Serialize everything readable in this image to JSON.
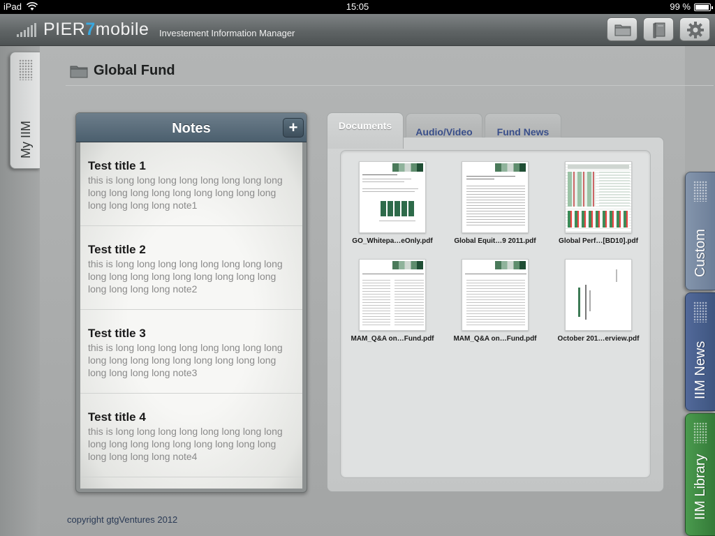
{
  "status_bar": {
    "device": "iPad",
    "time": "15:05",
    "battery": "99 %"
  },
  "header": {
    "logo_prefix": "PIER",
    "logo_seven": "7",
    "logo_suffix": "mobile",
    "tagline": "Investement Information Manager",
    "buttons": [
      {
        "name": "folder-button",
        "icon": "folder-icon"
      },
      {
        "name": "book-button",
        "icon": "book-icon"
      },
      {
        "name": "settings-button",
        "icon": "gear-icon"
      }
    ]
  },
  "left_tab": {
    "label": "My IIM"
  },
  "page": {
    "title": "Global Fund"
  },
  "notes": {
    "title": "Notes",
    "add_label": "+",
    "items": [
      {
        "title": "Test title 1",
        "body": "this is long long long long long long long long long long long long long long long long long long long long long note1"
      },
      {
        "title": "Test title 2",
        "body": "this is long long long long long long long long long long long long long long long long long long long long long note2"
      },
      {
        "title": "Test title 3",
        "body": "this is long long long long long long long long long long long long long long long long long long long long long note3"
      },
      {
        "title": "Test title 4",
        "body": "this is long long long long long long long long long long long long long long long long long long long long long note4"
      }
    ]
  },
  "docs": {
    "tabs": [
      {
        "label": "Documents",
        "active": true
      },
      {
        "label": "Audio/Video",
        "active": false
      },
      {
        "label": "Fund News",
        "active": false
      }
    ],
    "files": [
      {
        "name": "GO_Whitepa…eOnly.pdf"
      },
      {
        "name": "Global Equit…9 2011.pdf"
      },
      {
        "name": "Global Perf…[BD10].pdf"
      },
      {
        "name": "MAM_Q&A on…Fund.pdf"
      },
      {
        "name": "MAM_Q&A on…Fund.pdf"
      },
      {
        "name": "October 201…erview.pdf"
      }
    ]
  },
  "right_tabs": [
    {
      "label": "Custom",
      "color": "#7f8fa6"
    },
    {
      "label": "IIM News",
      "color": "#4a6390"
    },
    {
      "label": "IIM Library",
      "color": "#3f8a43"
    }
  ],
  "footer": {
    "copyright": "copyright gtgVentures 2012"
  }
}
